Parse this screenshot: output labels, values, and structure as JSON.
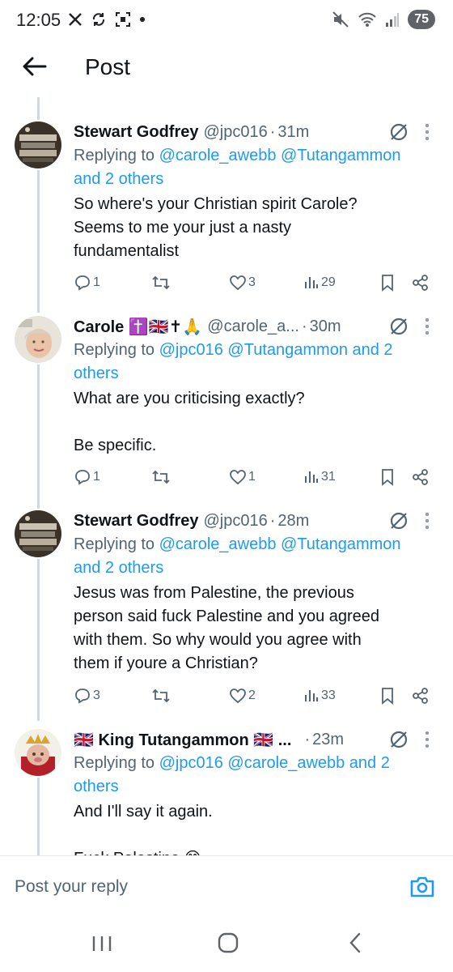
{
  "status_bar": {
    "time": "12:05",
    "battery": "75"
  },
  "header": {
    "title": "Post"
  },
  "tweets": [
    {
      "name": "Stewart Godfrey",
      "handle": "@jpc016",
      "time": "31m",
      "replying_prefix": "Replying to ",
      "replying_mentions": "@carole_awebb @Tutangammon",
      "replying_line2": "and 2 others",
      "text_lines": [
        "So where's your Christian spirit Carole?",
        "Seems to me your just a nasty",
        "fundamentalist"
      ],
      "replies": "1",
      "retweets": "",
      "likes": "3",
      "views": "29"
    },
    {
      "name": "Carole ✝️🇬🇧✝🙏",
      "handle": "@carole_a...",
      "time": "30m",
      "replying_prefix": "Replying to ",
      "replying_mentions": "@jpc016 @Tutangammon and 2",
      "replying_line2": "others",
      "text_lines": [
        "What are you criticising exactly?",
        "",
        "Be specific."
      ],
      "replies": "1",
      "retweets": "",
      "likes": "1",
      "views": "31"
    },
    {
      "name": "Stewart Godfrey",
      "handle": "@jpc016",
      "time": "28m",
      "replying_prefix": "Replying to ",
      "replying_mentions": "@carole_awebb @Tutangammon",
      "replying_line2": "and 2 others",
      "text_lines": [
        "Jesus was from Palestine, the previous",
        "person said fuck Palestine and you agreed",
        "with them. So why would you agree with",
        "them if youre a Christian?"
      ],
      "replies": "3",
      "retweets": "",
      "likes": "2",
      "views": "33"
    },
    {
      "name": "🇬🇧 King Tutangammon 🇬🇧 ...",
      "handle": "",
      "time": "23m",
      "replying_prefix": "Replying to ",
      "replying_mentions": "@jpc016 @carole_awebb and 2",
      "replying_line2": "others",
      "text_lines": [
        "And I'll say it again.",
        "",
        "Fuck Palestine 😊"
      ]
    }
  ],
  "reply_bar": {
    "placeholder": "Post your reply"
  },
  "colors": {
    "accent": "#1d9bf0",
    "text": "#0f1419",
    "muted": "#536471"
  }
}
